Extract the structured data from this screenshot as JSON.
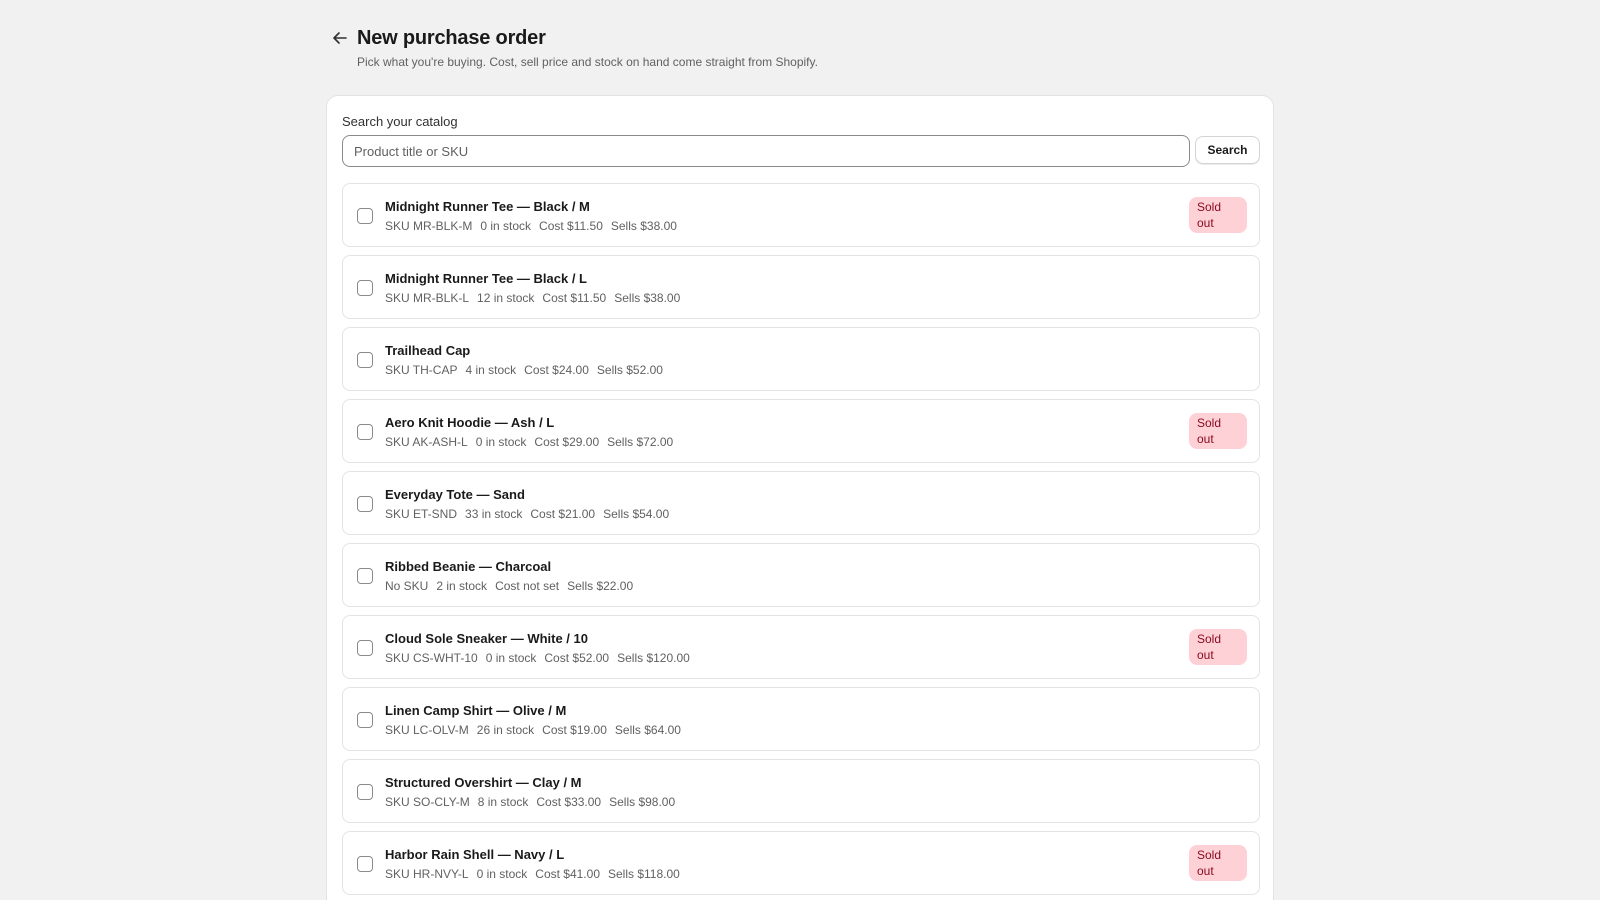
{
  "header": {
    "title": "New purchase order",
    "subtitle": "Pick what you're buying. Cost, sell price and stock on hand come straight from Shopify.",
    "back_icon": "arrow-left-icon"
  },
  "search": {
    "label": "Search your catalog",
    "placeholder": "Product title or SKU",
    "value": "",
    "button_label": "Search"
  },
  "colors": {
    "background": "#f1f1f1",
    "badge_bg": "#fed1d7",
    "badge_text": "#8e0b21"
  },
  "items": [
    {
      "title": "Midnight Runner Tee — Black / M",
      "sku": "SKU MR-BLK-M",
      "stock": "0 in stock",
      "cost": "Cost $11.50",
      "sells": "Sells $38.00",
      "badge": "Sold out"
    },
    {
      "title": "Midnight Runner Tee — Black / L",
      "sku": "SKU MR-BLK-L",
      "stock": "12 in stock",
      "cost": "Cost $11.50",
      "sells": "Sells $38.00",
      "badge": ""
    },
    {
      "title": "Trailhead Cap",
      "sku": "SKU TH-CAP",
      "stock": "4 in stock",
      "cost": "Cost $24.00",
      "sells": "Sells $52.00",
      "badge": ""
    },
    {
      "title": "Aero Knit Hoodie — Ash / L",
      "sku": "SKU AK-ASH-L",
      "stock": "0 in stock",
      "cost": "Cost $29.00",
      "sells": "Sells $72.00",
      "badge": "Sold out"
    },
    {
      "title": "Everyday Tote — Sand",
      "sku": "SKU ET-SND",
      "stock": "33 in stock",
      "cost": "Cost $21.00",
      "sells": "Sells $54.00",
      "badge": ""
    },
    {
      "title": "Ribbed Beanie — Charcoal",
      "sku": "No SKU",
      "stock": "2 in stock",
      "cost": "Cost not set",
      "sells": "Sells $22.00",
      "badge": ""
    },
    {
      "title": "Cloud Sole Sneaker — White / 10",
      "sku": "SKU CS-WHT-10",
      "stock": "0 in stock",
      "cost": "Cost $52.00",
      "sells": "Sells $120.00",
      "badge": "Sold out"
    },
    {
      "title": "Linen Camp Shirt — Olive / M",
      "sku": "SKU LC-OLV-M",
      "stock": "26 in stock",
      "cost": "Cost $19.00",
      "sells": "Sells $64.00",
      "badge": ""
    },
    {
      "title": "Structured Overshirt — Clay / M",
      "sku": "SKU SO-CLY-M",
      "stock": "8 in stock",
      "cost": "Cost $33.00",
      "sells": "Sells $98.00",
      "badge": ""
    },
    {
      "title": "Harbor Rain Shell — Navy / L",
      "sku": "SKU HR-NVY-L",
      "stock": "0 in stock",
      "cost": "Cost $41.00",
      "sells": "Sells $118.00",
      "badge": "Sold out"
    }
  ]
}
